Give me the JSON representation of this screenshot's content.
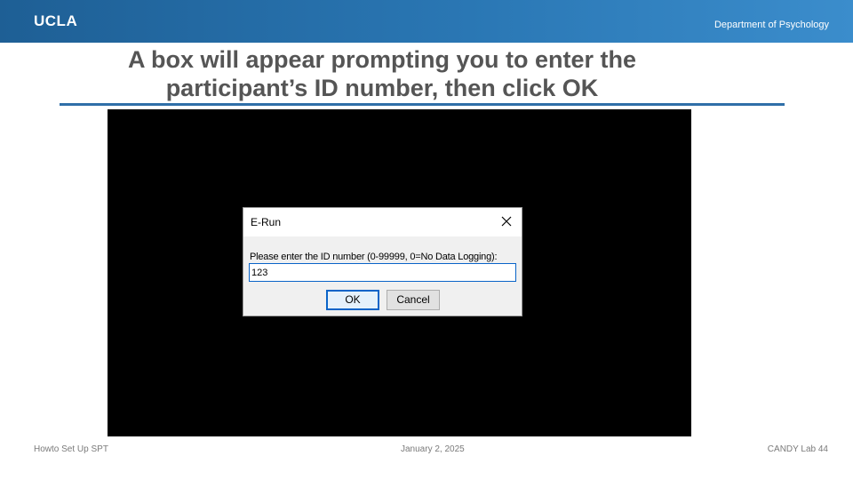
{
  "header": {
    "logo_text": "UCLA",
    "department": "Department of Psychology",
    "brand_color": "#2774ae"
  },
  "slide": {
    "title_line1": "A box will appear prompting you to enter the",
    "title_line2": "participant’s ID number, then click OK"
  },
  "dialog": {
    "title": "E-Run",
    "close_icon": "close-icon",
    "prompt": "Please enter the ID number (0-99999, 0=No Data Logging):",
    "id_value": "123",
    "ok_label": "OK",
    "cancel_label": "Cancel"
  },
  "footer": {
    "left": "Howto Set Up SPT",
    "center": "January 2, 2025",
    "right": "CANDY Lab 44"
  }
}
